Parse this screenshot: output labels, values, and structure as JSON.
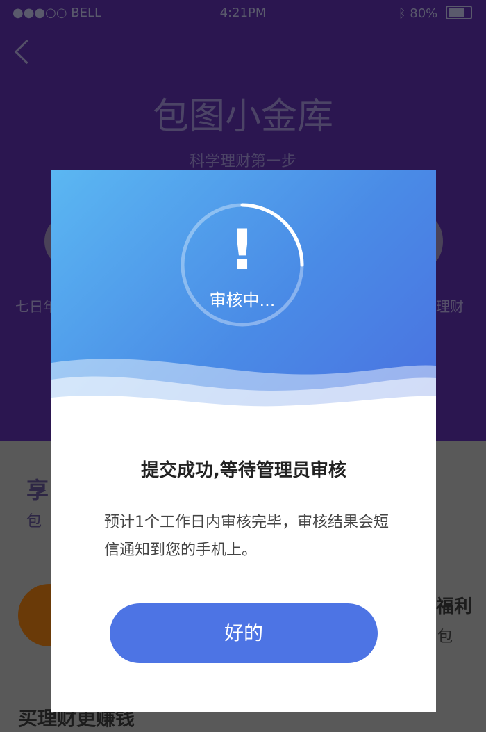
{
  "status_bar": {
    "carrier": "●●●○○ BELL",
    "time": "4:21PM",
    "battery": "80%"
  },
  "background": {
    "title": "包图小金库",
    "subtitle": "科学理财第一步",
    "left_label": "七日年",
    "right_label": "理财",
    "section_title": "享",
    "section_sub": "包",
    "welfare": "福利",
    "packet": "包",
    "bottom_title": "买理财更赚钱"
  },
  "modal": {
    "status_text": "审核中...",
    "exclaim": "!",
    "title": "提交成功,等待管理员审核",
    "body": "预计1个工作日内审核完毕，审核结果会短信通知到您的手机上。",
    "ok_label": "好的"
  },
  "colors": {
    "accent": "#4d74e4",
    "header_start": "#5bb7f2",
    "header_end": "#4a6fe0",
    "overlay_top": "#2b1650"
  }
}
